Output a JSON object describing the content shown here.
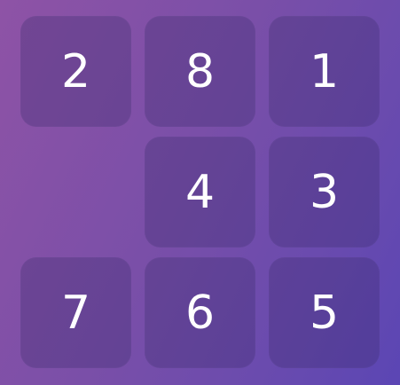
{
  "puzzle": {
    "tiles": {
      "r0c0": "2",
      "r0c1": "8",
      "r0c2": "1",
      "r1c1": "4",
      "r1c2": "3",
      "r2c0": "7",
      "r2c1": "6",
      "r2c2": "5"
    },
    "empty_cell": "r1c0"
  },
  "colors": {
    "background_start": "#8e53a6",
    "background_end": "#5b46b4",
    "tile_text": "#ffffff"
  }
}
